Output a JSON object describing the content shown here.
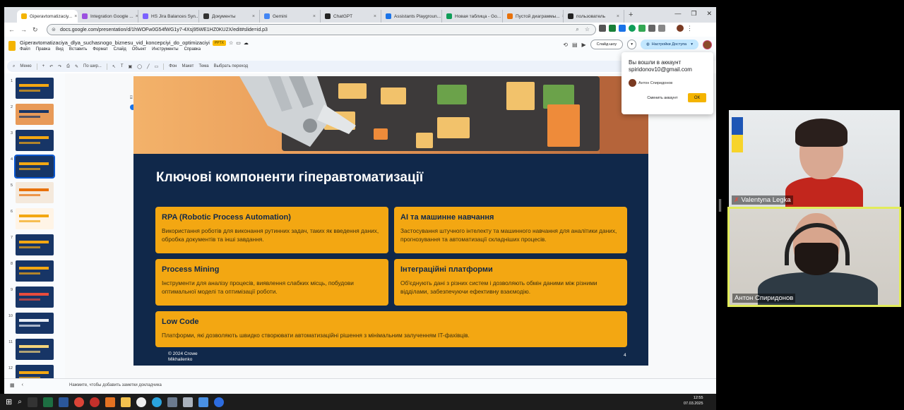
{
  "browser": {
    "tabs": [
      {
        "label": "Giperavtomatizaciy...",
        "color": "#f4b400",
        "active": true
      },
      {
        "label": "Integration Google ...",
        "color": "#9b51e0",
        "active": false
      },
      {
        "label": "HS Jira Balances Syn...",
        "color": "#7b61ff",
        "active": false
      },
      {
        "label": "Документы",
        "color": "#333333",
        "active": false
      },
      {
        "label": "Gemini",
        "color": "#4285f4",
        "active": false
      },
      {
        "label": "ChatGPT",
        "color": "#222222",
        "active": false
      },
      {
        "label": "Assistants Playgroun...",
        "color": "#1a73e8",
        "active": false
      },
      {
        "label": "Новая таблица - Go...",
        "color": "#0f9d58",
        "active": false
      },
      {
        "label": "Пустой диаграммы...",
        "color": "#e8710a",
        "active": false
      },
      {
        "label": "пользователь",
        "color": "#222222",
        "active": false
      }
    ],
    "tab_plus": "+",
    "url": "docs.google.com/presentation/d/1hWOFw0G54fWG1y7-4Xsj95WE1HZ0KU2X/edit#slide=id.p3"
  },
  "app": {
    "doc_title": "Giperavtomatizaciya_dlya_suchasnogo_biznesu_vid_koncepciyi_do_optimizaciyi",
    "doc_badge": "PPTX",
    "menu": [
      "Файл",
      "Правка",
      "Вид",
      "Вставить",
      "Формат",
      "Слайд",
      "Объект",
      "Инструменты",
      "Справка"
    ],
    "slideshow_label": "Слайд-шоу",
    "share_label": "Настройки Доступа",
    "editbar": {
      "menu_label": "Меню",
      "zoom_label": "По шир...",
      "bg_label": "Фон",
      "layout_label": "Макет",
      "theme_label": "Тема",
      "transition_label": "Выбрать переход"
    }
  },
  "filmstrip": {
    "slides": [
      {
        "num": "1",
        "bg": "#173566",
        "accent": "#f3a712"
      },
      {
        "num": "2",
        "bg": "#e89a58",
        "accent": "#173566"
      },
      {
        "num": "3",
        "bg": "#173566",
        "accent": "#f3a712"
      },
      {
        "num": "4",
        "bg": "#173566",
        "accent": "#f3a712",
        "selected": true
      },
      {
        "num": "5",
        "bg": "#f4e9dc",
        "accent": "#e8710a"
      },
      {
        "num": "6",
        "bg": "#fff4e6",
        "accent": "#f3a712"
      },
      {
        "num": "7",
        "bg": "#173566",
        "accent": "#f3a712"
      },
      {
        "num": "8",
        "bg": "#173566",
        "accent": "#f3a712"
      },
      {
        "num": "9",
        "bg": "#173566",
        "accent": "#e84c3d"
      },
      {
        "num": "10",
        "bg": "#173566",
        "accent": "#e9eef5"
      },
      {
        "num": "11",
        "bg": "#173566",
        "accent": "#f3d37a"
      },
      {
        "num": "12",
        "bg": "#173566",
        "accent": "#f3a712"
      }
    ]
  },
  "slide": {
    "title": "Ключові компоненти гіперавтоматизації",
    "cards": [
      {
        "title": "RPA (Robotic Process Automation)",
        "text": "Використання роботів для виконання рутинних задач, таких як введення даних, обробка документів та інші завдання."
      },
      {
        "title": "AI та машинне навчання",
        "text": "Застосування штучного інтелекту та машинного навчання для аналітики даних, прогнозування та автоматизації складніших процесів."
      },
      {
        "title": "Process Mining",
        "text": "Інструменти для аналізу процесів, виявлення слабких місць, побудови оптимальної моделі та оптимізації роботи."
      },
      {
        "title": "Інтеграційні платформи",
        "text": "Об'єднують дані з різних систем і дозволяють обмін даними між різними відділами, забезпечуючи ефективну взаємодію."
      },
      {
        "title": "Low Code",
        "text": "Платформи, які дозволяють швидко створювати автоматизаційні рішення з мінімальним залученням IT-фахівців."
      }
    ],
    "footer_line1": "© 2024 Crowe",
    "footer_line2": "Mikhailenko",
    "page_number": "4"
  },
  "notes": {
    "placeholder": "Нажмите, чтобы добавить заметки докладчика"
  },
  "account_popup": {
    "line1": "Вы вошли в аккаунт",
    "email": "spiridonov10@gmail.com",
    "name": "Антон Спиридонов",
    "switch_label": "Сменить аккаунт",
    "ok_label": "ОК"
  },
  "participants": [
    {
      "name": "Valentyna Legka",
      "muted": true
    },
    {
      "name": "Антон Спиридонов",
      "muted": false,
      "speaking": true
    }
  ],
  "clock": {
    "time": "12:55",
    "date": "07.03.2025"
  },
  "colors": {
    "slide_bg": "#10284a",
    "card_bg": "#f3a712",
    "brand_yellow": "#f4b400",
    "speaking_border": "#e2ec5a"
  }
}
